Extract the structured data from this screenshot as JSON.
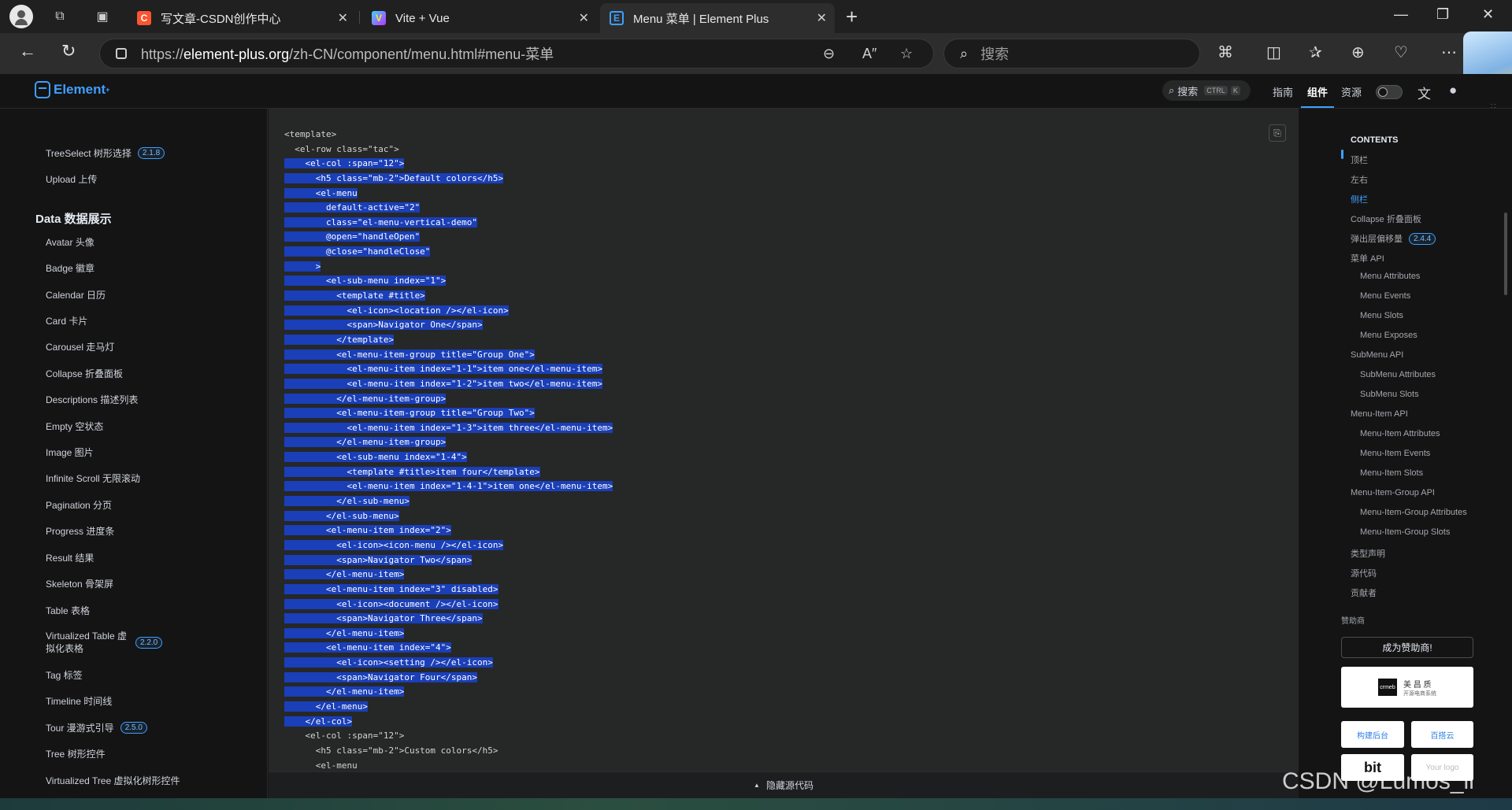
{
  "browser": {
    "tabs": [
      {
        "title": "写文章-CSDN创作中心",
        "favicon": "C"
      },
      {
        "title": "Vite + Vue",
        "favicon": "V"
      },
      {
        "title": "Menu 菜单 | Element Plus",
        "favicon": "E"
      }
    ],
    "url_prefix": "https://",
    "url_host": "element-plus.org",
    "url_path": "/zh-CN/component/menu.html#menu-菜单",
    "search_placeholder": "搜索"
  },
  "site": {
    "logo": "Element",
    "search_label": "搜索",
    "search_kbd1": "CTRL",
    "search_kbd2": "K",
    "nav": [
      "指南",
      "组件",
      "资源"
    ]
  },
  "sidebar": {
    "items_top": [
      {
        "label": "TreeSelect 树形选择",
        "badge": "2.1.8"
      },
      {
        "label": "Upload 上传",
        "badge": ""
      }
    ],
    "group": "Data 数据展示",
    "items": [
      {
        "label": "Avatar 头像",
        "badge": ""
      },
      {
        "label": "Badge 徽章",
        "badge": ""
      },
      {
        "label": "Calendar 日历",
        "badge": ""
      },
      {
        "label": "Card 卡片",
        "badge": ""
      },
      {
        "label": "Carousel 走马灯",
        "badge": ""
      },
      {
        "label": "Collapse 折叠面板",
        "badge": ""
      },
      {
        "label": "Descriptions 描述列表",
        "badge": ""
      },
      {
        "label": "Empty 空状态",
        "badge": ""
      },
      {
        "label": "Image 图片",
        "badge": ""
      },
      {
        "label": "Infinite Scroll 无限滚动",
        "badge": ""
      },
      {
        "label": "Pagination 分页",
        "badge": ""
      },
      {
        "label": "Progress 进度条",
        "badge": ""
      },
      {
        "label": "Result 结果",
        "badge": ""
      },
      {
        "label": "Skeleton 骨架屏",
        "badge": ""
      },
      {
        "label": "Table 表格",
        "badge": ""
      },
      {
        "label": "Virtualized Table 虚拟化表格",
        "badge": "2.2.0"
      },
      {
        "label": "Tag 标签",
        "badge": ""
      },
      {
        "label": "Timeline 时间线",
        "badge": ""
      },
      {
        "label": "Tour 漫游式引导",
        "badge": "2.5.0"
      },
      {
        "label": "Tree 树形控件",
        "badge": ""
      },
      {
        "label": "Virtualized Tree 虚拟化树形控件",
        "badge": ""
      }
    ]
  },
  "code": {
    "lines": [
      {
        "text": "<template>",
        "sel": false
      },
      {
        "text": "  <el-row class=\"tac\">",
        "sel": false
      },
      {
        "text": "    <el-col :span=\"12\">",
        "sel": true
      },
      {
        "text": "      <h5 class=\"mb-2\">Default colors</h5>",
        "sel": true
      },
      {
        "text": "      <el-menu",
        "sel": true
      },
      {
        "text": "        default-active=\"2\"",
        "sel": true
      },
      {
        "text": "        class=\"el-menu-vertical-demo\"",
        "sel": true
      },
      {
        "text": "        @open=\"handleOpen\"",
        "sel": true
      },
      {
        "text": "        @close=\"handleClose\"",
        "sel": true
      },
      {
        "text": "      >",
        "sel": true
      },
      {
        "text": "        <el-sub-menu index=\"1\">",
        "sel": true
      },
      {
        "text": "          <template #title>",
        "sel": true
      },
      {
        "text": "            <el-icon><location /></el-icon>",
        "sel": true
      },
      {
        "text": "            <span>Navigator One</span>",
        "sel": true
      },
      {
        "text": "          </template>",
        "sel": true
      },
      {
        "text": "          <el-menu-item-group title=\"Group One\">",
        "sel": true
      },
      {
        "text": "            <el-menu-item index=\"1-1\">item one</el-menu-item>",
        "sel": true
      },
      {
        "text": "            <el-menu-item index=\"1-2\">item two</el-menu-item>",
        "sel": true
      },
      {
        "text": "          </el-menu-item-group>",
        "sel": true
      },
      {
        "text": "          <el-menu-item-group title=\"Group Two\">",
        "sel": true
      },
      {
        "text": "            <el-menu-item index=\"1-3\">item three</el-menu-item>",
        "sel": true
      },
      {
        "text": "          </el-menu-item-group>",
        "sel": true
      },
      {
        "text": "          <el-sub-menu index=\"1-4\">",
        "sel": true
      },
      {
        "text": "            <template #title>item four</template>",
        "sel": true
      },
      {
        "text": "            <el-menu-item index=\"1-4-1\">item one</el-menu-item>",
        "sel": true
      },
      {
        "text": "          </el-sub-menu>",
        "sel": true
      },
      {
        "text": "        </el-sub-menu>",
        "sel": true
      },
      {
        "text": "        <el-menu-item index=\"2\">",
        "sel": true
      },
      {
        "text": "          <el-icon><icon-menu /></el-icon>",
        "sel": true
      },
      {
        "text": "          <span>Navigator Two</span>",
        "sel": true
      },
      {
        "text": "        </el-menu-item>",
        "sel": true
      },
      {
        "text": "        <el-menu-item index=\"3\" disabled>",
        "sel": true
      },
      {
        "text": "          <el-icon><document /></el-icon>",
        "sel": true
      },
      {
        "text": "          <span>Navigator Three</span>",
        "sel": true
      },
      {
        "text": "        </el-menu-item>",
        "sel": true
      },
      {
        "text": "        <el-menu-item index=\"4\">",
        "sel": true
      },
      {
        "text": "          <el-icon><setting /></el-icon>",
        "sel": true
      },
      {
        "text": "          <span>Navigator Four</span>",
        "sel": true
      },
      {
        "text": "        </el-menu-item>",
        "sel": true
      },
      {
        "text": "      </el-menu>",
        "sel": true
      },
      {
        "text": "    </el-col>",
        "sel": true
      },
      {
        "text": "    <el-col :span=\"12\">",
        "sel": false
      },
      {
        "text": "      <h5 class=\"mb-2\">Custom colors</h5>",
        "sel": false
      },
      {
        "text": "      <el-menu",
        "sel": false
      }
    ],
    "hide_label": "隐藏源代码"
  },
  "toc": {
    "title": "CONTENTS",
    "items": [
      {
        "label": "顶栏",
        "level": 1,
        "active": false,
        "badge": ""
      },
      {
        "label": "左右",
        "level": 1,
        "active": false,
        "badge": ""
      },
      {
        "label": "侧栏",
        "level": 1,
        "active": true,
        "badge": ""
      },
      {
        "label": "Collapse 折叠面板",
        "level": 1,
        "active": false,
        "badge": ""
      },
      {
        "label": "弹出层偏移量",
        "level": 1,
        "active": false,
        "badge": "2.4.4"
      },
      {
        "label": "菜单 API",
        "level": 1,
        "active": false,
        "badge": ""
      },
      {
        "label": "Menu Attributes",
        "level": 2,
        "active": false,
        "badge": ""
      },
      {
        "label": "Menu Events",
        "level": 2,
        "active": false,
        "badge": ""
      },
      {
        "label": "Menu Slots",
        "level": 2,
        "active": false,
        "badge": ""
      },
      {
        "label": "Menu Exposes",
        "level": 2,
        "active": false,
        "badge": ""
      },
      {
        "label": "SubMenu API",
        "level": 1,
        "active": false,
        "badge": ""
      },
      {
        "label": "SubMenu Attributes",
        "level": 2,
        "active": false,
        "badge": ""
      },
      {
        "label": "SubMenu Slots",
        "level": 2,
        "active": false,
        "badge": ""
      },
      {
        "label": "Menu-Item API",
        "level": 1,
        "active": false,
        "badge": ""
      },
      {
        "label": "Menu-Item Attributes",
        "level": 2,
        "active": false,
        "badge": ""
      },
      {
        "label": "Menu-Item Events",
        "level": 2,
        "active": false,
        "badge": ""
      },
      {
        "label": "Menu-Item Slots",
        "level": 2,
        "active": false,
        "badge": ""
      },
      {
        "label": "Menu-Item-Group API",
        "level": 1,
        "active": false,
        "badge": ""
      },
      {
        "label": "Menu-Item-Group Attributes",
        "level": 2,
        "active": false,
        "badge": ""
      },
      {
        "label": "Menu-Item-Group Slots",
        "level": 2,
        "active": false,
        "badge": ""
      },
      {
        "label": "类型声明",
        "level": 1,
        "active": false,
        "badge": ""
      },
      {
        "label": "源代码",
        "level": 1,
        "active": false,
        "badge": ""
      },
      {
        "label": "贡献者",
        "level": 1,
        "active": false,
        "badge": ""
      }
    ],
    "sponsors_label": "赞助商",
    "become_sponsor": "成为赞助商!",
    "sponsor1": "美 昌 质",
    "sponsor1_sub": "开源电商系统",
    "sponsor2": "构建后台",
    "sponsor3": "百搭云",
    "sponsor4": "bit",
    "sponsor5": "Your logo"
  },
  "watermark": "CSDN @Lumos_ll",
  "colors": {
    "accent": "#409eff",
    "selection": "#1a3fb8",
    "bg": "#141414"
  }
}
